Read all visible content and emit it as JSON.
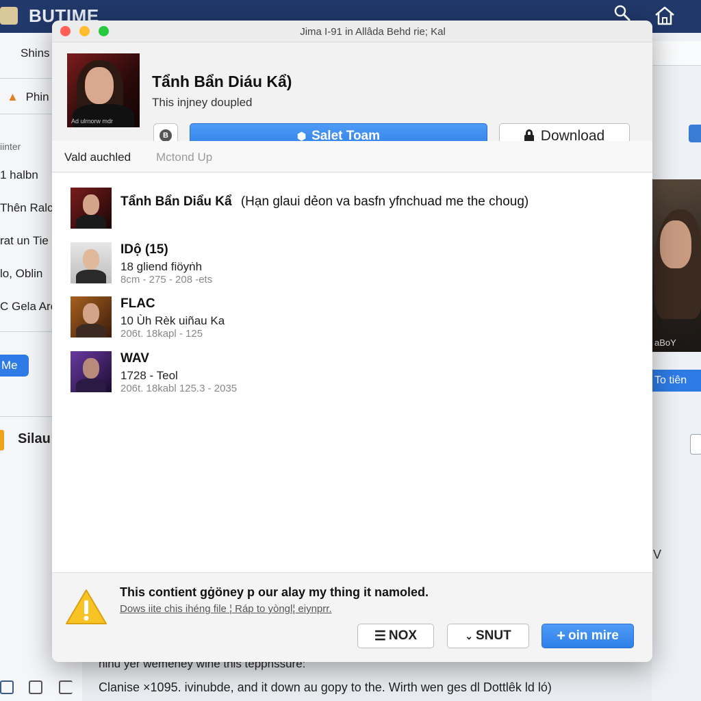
{
  "background": {
    "app_title": "BUTIME",
    "left_items": [
      "Shins",
      "Phin",
      "iinter",
      "1 halbn",
      "Thên Ralc,",
      "rat un Tie",
      "lo, Oblin",
      "C Gela Are"
    ],
    "me_button": "Me",
    "silau_label": "Silau",
    "right_photo_label": "aBoY",
    "right_button": "To tiên",
    "right_letter": "V",
    "bottom_line1": "ninu yer wemeney wine this teppnssure:",
    "bottom_line2": "Clanise ×1095. ivinubde, and it down au gopy to the. Wirth wen ges dl Dottlêk ld ló)"
  },
  "dialog": {
    "window_title": "Jima I-91 in Allâda Behd rie; Kal",
    "header": {
      "title": "Tẩnh Bẩn Diáu Kẩ)",
      "subtitle": "This injney doupled",
      "art_caption": "Ad ulrnorw mdr",
      "lock_label": "B",
      "primary_button": "Salet Toam",
      "download_button": "Download"
    },
    "tabs": [
      "Vald auchled",
      "Mctond Up"
    ],
    "items": [
      {
        "name": "Tẩnh Bẩn Diẩu Kẩ",
        "detail": "(Hạn glaui dẻon va basfn yfnchuad me the choug)"
      },
      {
        "name": "IDộ (15)",
        "line1": "18 gliend fiöyṅh",
        "line2": "8cm - 275 - 208 -ets"
      },
      {
        "name": "FLAC",
        "line1": "10 Ùh Rèk uiñau Ka",
        "line2": "206t. 18kapl - 125"
      },
      {
        "name": "WAV",
        "line1": "1728 - Teol",
        "line2": "206t. 18kabl 125.3 - 2035"
      }
    ],
    "footer": {
      "warning_title": "This contient gġöney p our alay my thing it namoled.",
      "warning_link": "Dows iite chis ihéng file ¦ Ráp to yòngl¦ eiynprr.",
      "btn_nox": "NOX",
      "btn_snut": "SNUT",
      "btn_join": "oin mire"
    }
  },
  "icons": [
    "search-icon",
    "home-icon",
    "warning-icon",
    "lock-icon",
    "gear-icon"
  ],
  "colors": {
    "accent": "#2f7fe8",
    "titlebar": "#21386a",
    "warning": "#f7c325"
  }
}
